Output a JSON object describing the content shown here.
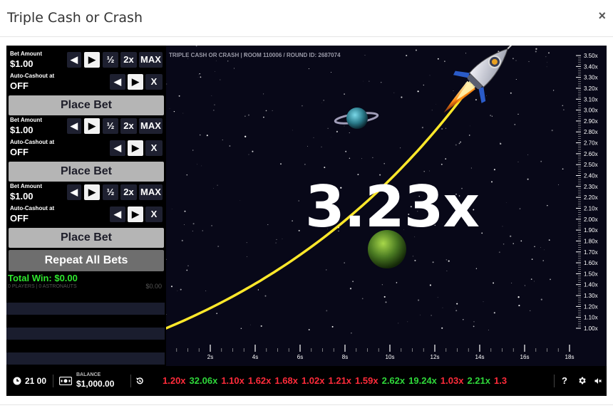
{
  "modal": {
    "title": "Triple Cash or Crash",
    "close": "×"
  },
  "bets": [
    {
      "bet_label": "Bet Amount",
      "bet_value": "$1.00",
      "half": "½",
      "double": "2x",
      "max": "MAX",
      "auto_label": "Auto-Cashout at",
      "auto_value": "OFF",
      "clear": "X",
      "place": "Place Bet"
    },
    {
      "bet_label": "Bet Amount",
      "bet_value": "$1.00",
      "half": "½",
      "double": "2x",
      "max": "MAX",
      "auto_label": "Auto-Cashout at",
      "auto_value": "OFF",
      "clear": "X",
      "place": "Place Bet"
    },
    {
      "bet_label": "Bet Amount",
      "bet_value": "$1.00",
      "half": "½",
      "double": "2x",
      "max": "MAX",
      "auto_label": "Auto-Cashout at",
      "auto_value": "OFF",
      "clear": "X",
      "place": "Place Bet"
    }
  ],
  "repeat_all": "Repeat All Bets",
  "total_win": "Total Win: $0.00",
  "players": "0 PLAYERS | 0 ASTRONAUTS",
  "pot": "$0.00",
  "game": {
    "room_label": "TRIPLE CASH OR CRASH  |  ROOM 110006 / ROUND ID: 2687074",
    "multiplier": "3.23x",
    "y_ticks": [
      "3.50x",
      "3.40x",
      "3.30x",
      "3.20x",
      "3.10x",
      "3.00x",
      "2.90x",
      "2.80x",
      "2.70x",
      "2.60x",
      "2.50x",
      "2.40x",
      "2.30x",
      "2.20x",
      "2.10x",
      "2.00x",
      "1.90x",
      "1.80x",
      "1.70x",
      "1.60x",
      "1.50x",
      "1.40x",
      "1.30x",
      "1.20x",
      "1.10x",
      "1.00x"
    ],
    "x_ticks": [
      "2s",
      "4s",
      "6s",
      "8s",
      "10s",
      "12s",
      "14s",
      "16s",
      "18s"
    ],
    "curve_color": "#ffe82a"
  },
  "footer": {
    "clock": "21 00",
    "balance_label": "BALANCE",
    "balance_value": "$1,000.00",
    "history": [
      {
        "v": "1.20x",
        "c": "red"
      },
      {
        "v": "32.06x",
        "c": "green"
      },
      {
        "v": "1.10x",
        "c": "red"
      },
      {
        "v": "1.62x",
        "c": "red"
      },
      {
        "v": "1.68x",
        "c": "red"
      },
      {
        "v": "1.02x",
        "c": "red"
      },
      {
        "v": "1.21x",
        "c": "red"
      },
      {
        "v": "1.59x",
        "c": "red"
      },
      {
        "v": "2.62x",
        "c": "green"
      },
      {
        "v": "19.24x",
        "c": "green"
      },
      {
        "v": "1.03x",
        "c": "red"
      },
      {
        "v": "2.21x",
        "c": "green"
      },
      {
        "v": "1.3",
        "c": "red"
      }
    ],
    "help": "?"
  }
}
